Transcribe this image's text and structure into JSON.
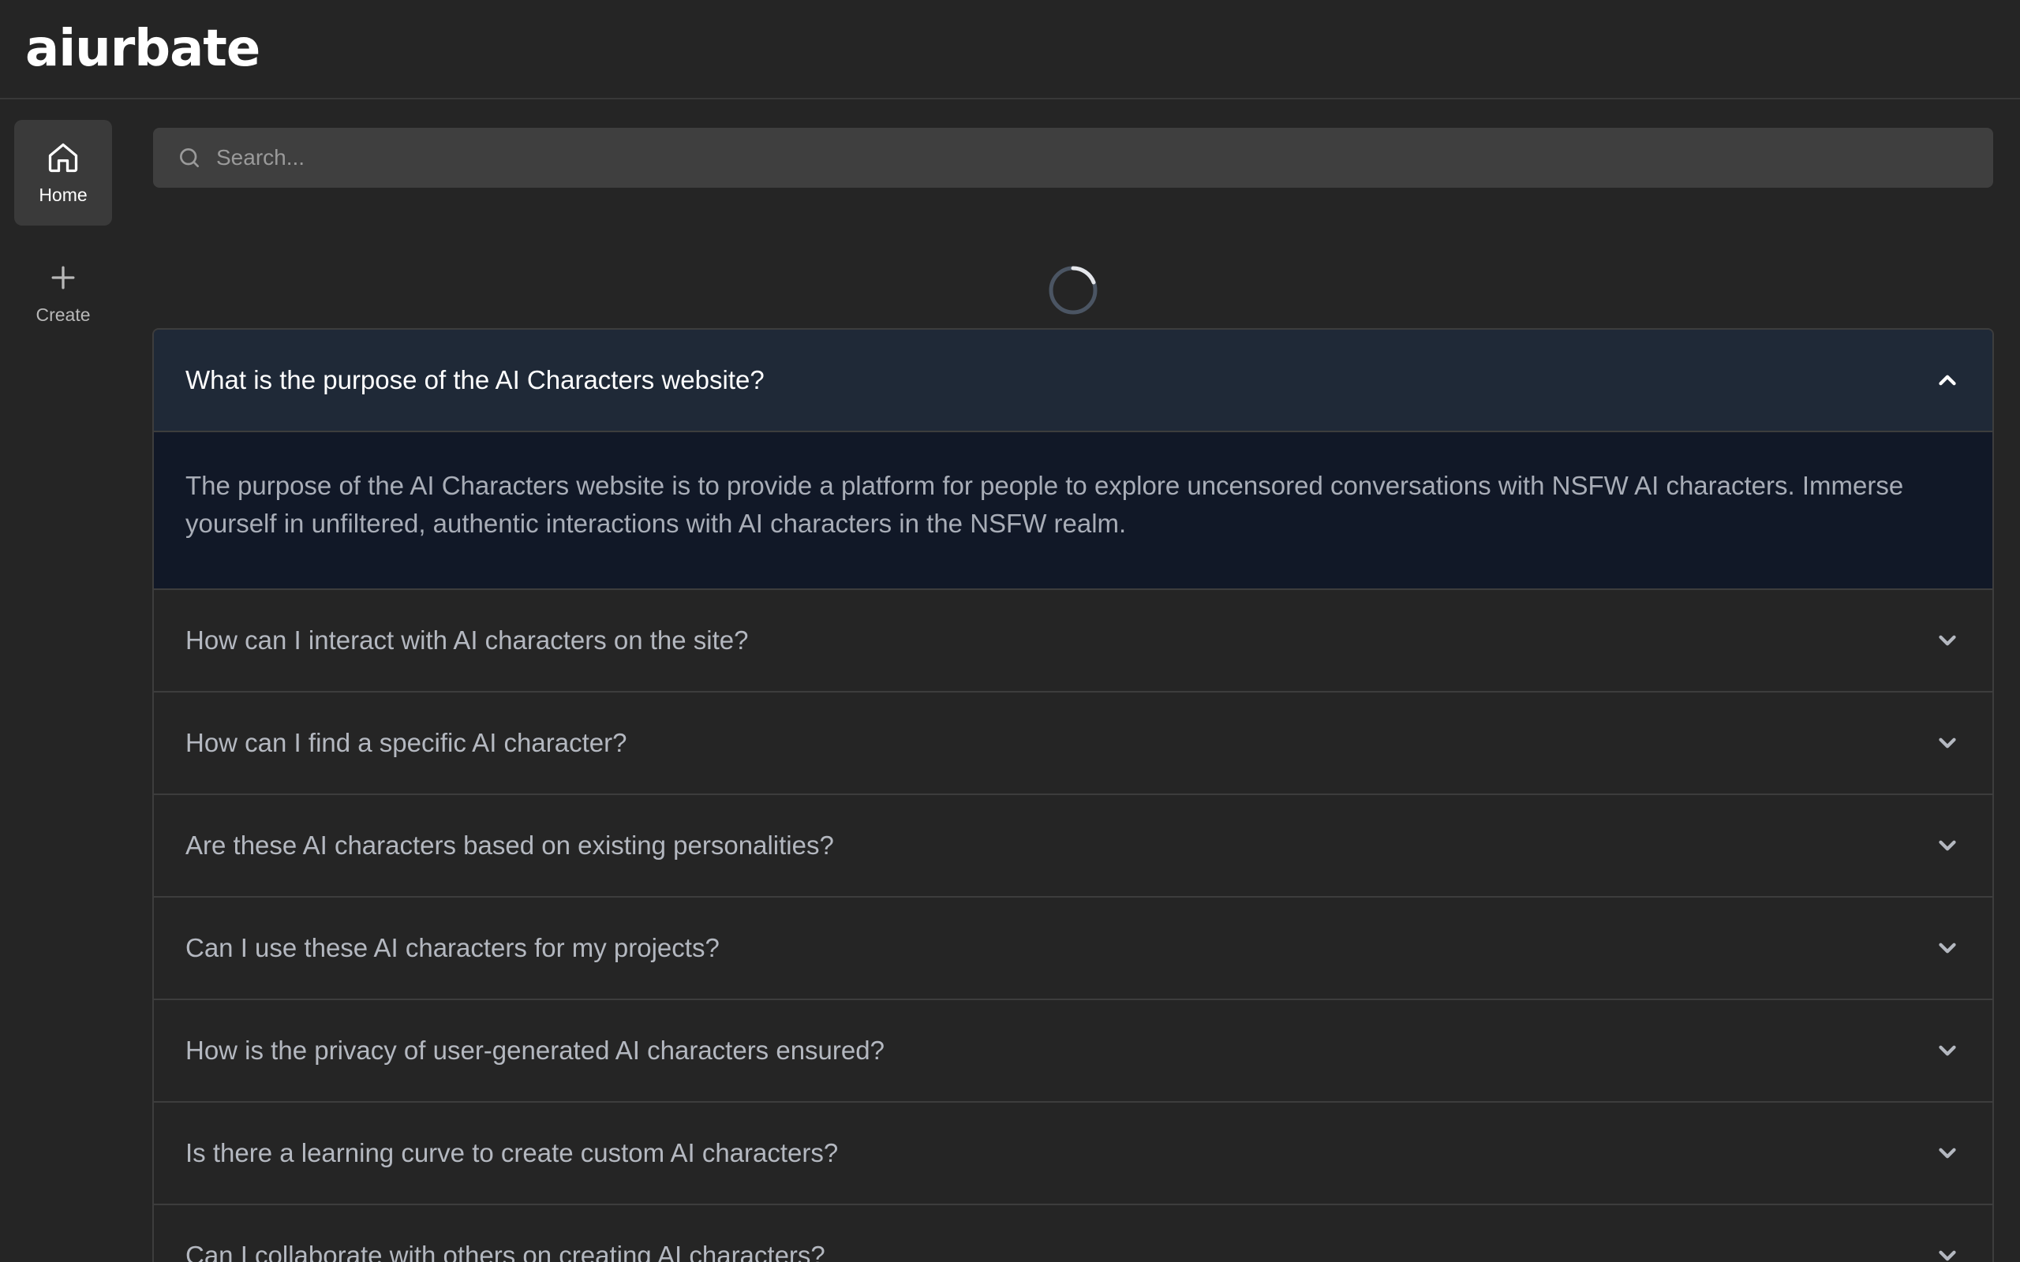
{
  "header": {
    "logo": "aiurbate"
  },
  "sidebar": {
    "items": [
      {
        "label": "Home",
        "icon": "home-icon",
        "active": true
      },
      {
        "label": "Create",
        "icon": "plus-icon",
        "active": false
      }
    ]
  },
  "search": {
    "placeholder": "Search...",
    "value": ""
  },
  "faq": {
    "items": [
      {
        "question": "What is the purpose of the AI Characters website?",
        "expanded": true,
        "answer": "The purpose of the AI Characters website is to provide a platform for people to explore uncensored conversations with NSFW AI characters. Immerse yourself in unfiltered, authentic interactions with AI characters in the NSFW realm."
      },
      {
        "question": "How can I interact with AI characters on the site?",
        "expanded": false
      },
      {
        "question": "How can I find a specific AI character?",
        "expanded": false
      },
      {
        "question": "Are these AI characters based on existing personalities?",
        "expanded": false
      },
      {
        "question": "Can I use these AI characters for my projects?",
        "expanded": false
      },
      {
        "question": "How is the privacy of user-generated AI characters ensured?",
        "expanded": false
      },
      {
        "question": "Is there a learning curve to create custom AI characters?",
        "expanded": false
      },
      {
        "question": "Can I collaborate with others on creating AI characters?",
        "expanded": false
      }
    ]
  },
  "colors": {
    "background": "#252525",
    "search_bg": "#3f3f3f",
    "faq_open_header": "#1f2937",
    "faq_open_body": "#111827",
    "border": "#3d3d3d"
  }
}
